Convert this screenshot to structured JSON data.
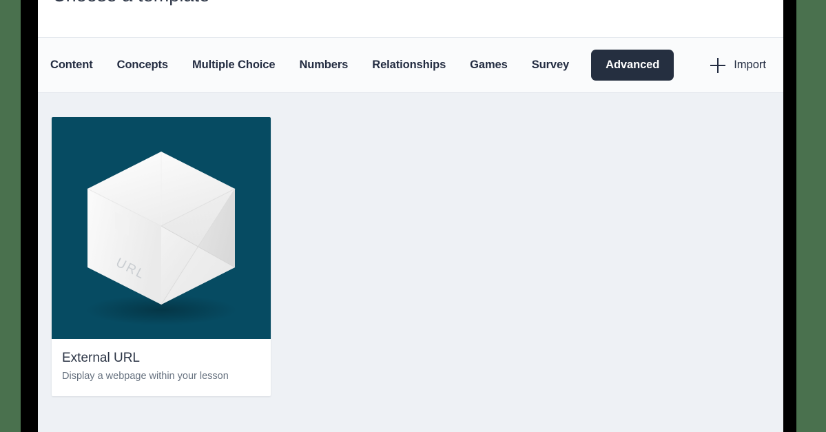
{
  "frame": {
    "outer_color": "#4a714e",
    "bezel_color": "#000000"
  },
  "header": {
    "title": "Choose a template",
    "background": "#ffffff"
  },
  "tab_bar": {
    "background": "#fafbfc",
    "active_tab_bg": "#252f40",
    "active_tab_fg": "#ffffff",
    "tabs": [
      {
        "label": "Content",
        "active": false
      },
      {
        "label": "Concepts",
        "active": false
      },
      {
        "label": "Multiple Choice",
        "active": false
      },
      {
        "label": "Numbers",
        "active": false
      },
      {
        "label": "Relationships",
        "active": false
      },
      {
        "label": "Games",
        "active": false
      },
      {
        "label": "Survey",
        "active": false
      },
      {
        "label": "Advanced",
        "active": true
      }
    ],
    "import": {
      "label": "Import",
      "icon": "plus-icon"
    }
  },
  "content": {
    "background": "#eef1f5",
    "cards": [
      {
        "title": "External URL",
        "subtitle": "Display a webpage within your lesson",
        "thumbnail": {
          "background": "#064b62",
          "icon": "isometric-cube-icon",
          "face_label": "URL"
        }
      }
    ]
  }
}
